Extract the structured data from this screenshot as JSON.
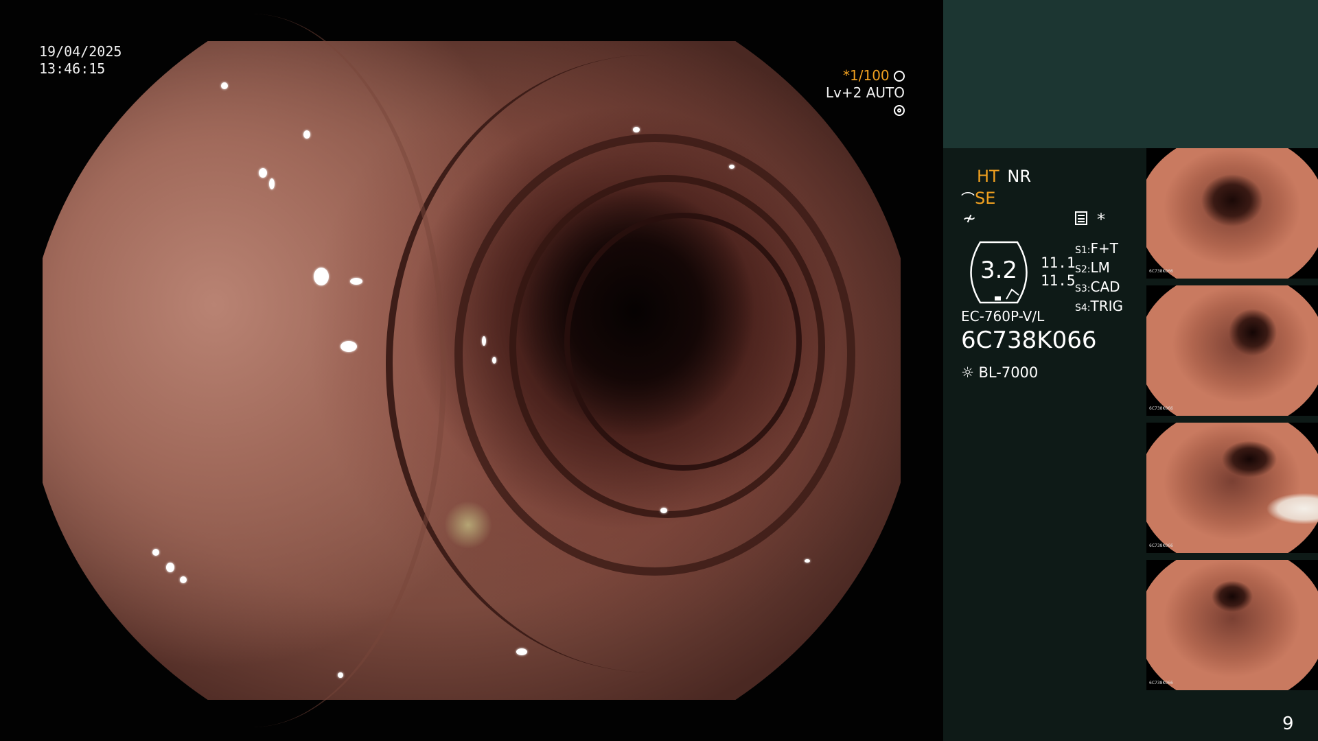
{
  "overlay": {
    "date": "19/04/2025",
    "time": "13:46:15",
    "shutter": "*1/100",
    "shutter_icon": "aperture-icon",
    "light_level": "Lv+2",
    "mode": "AUTO",
    "mode_icon": "auto-iris-icon"
  },
  "panel": {
    "ht": "HT",
    "nr": "NR",
    "se": "SE",
    "se_icon": "structure-enhance-icon",
    "color_icon": "color-mode-icon",
    "menu_icon": "settings-icon",
    "asterisk": "*",
    "scope_value": "3.2",
    "value_top": "11.1",
    "value_bottom": "11.5",
    "switches": [
      {
        "key": "S1",
        "value": "F+T"
      },
      {
        "key": "S2",
        "value": "LM"
      },
      {
        "key": "S3",
        "value": "CAD"
      },
      {
        "key": "S4",
        "value": "TRIG"
      }
    ],
    "scope_model": "EC-760P-V/L",
    "serial": "6C738K066",
    "light_source_icon": "light-source-icon",
    "light_source": "BL-7000",
    "page_number": "9"
  },
  "thumbnails": [
    {
      "serial": "6C738K066"
    },
    {
      "serial": "6C738K066"
    },
    {
      "serial": "6C738K066"
    },
    {
      "serial": "6C738K066"
    }
  ],
  "colors": {
    "accent": "#f0a020",
    "panel_top": "#1c3632",
    "panel": "#0e1a17"
  }
}
